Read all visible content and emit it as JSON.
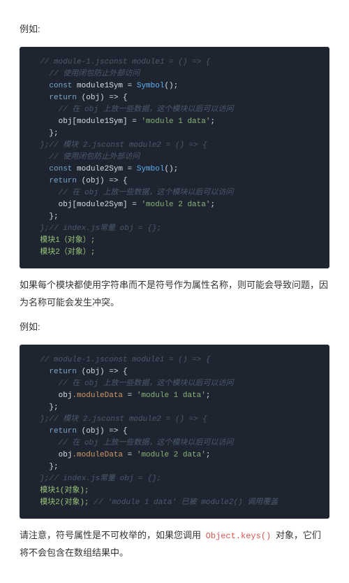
{
  "intro_label": "例如:",
  "code1": {
    "c1": "  // module-1.jsconst module1 = () => {",
    "c2": "    // 使用闭包防止外部访问",
    "l3_kw": "    const ",
    "l3_id": "module1Sym = ",
    "l3_fn": "Symbol",
    "l3_rest": "();",
    "l4_kw": "    return ",
    "l4_rest": "(obj) => {",
    "c5": "      // 在 obj 上放一些数据，这个模块以后可以访问",
    "l6_a": "      obj[module1Sym] = ",
    "l6_str": "'module 1 data'",
    "l6_b": ";",
    "l7": "    };",
    "c8": "  };// 模块 2.jsconst module2 = () => {",
    "c9": "    // 使用闭包防止外部访问",
    "l10_kw": "    const ",
    "l10_id": "module2Sym = ",
    "l10_fn": "Symbol",
    "l10_rest": "();",
    "l11_kw": "    return ",
    "l11_rest": "(obj) => {",
    "c12": "      // 在 obj 上放一些数据，这个模块以后可以访问",
    "l13_a": "      obj[module2Sym] = ",
    "l13_str": "'module 2 data'",
    "l13_b": ";",
    "l14": "    };",
    "c15": "  };// index.js常量 obj = {};",
    "l16": "  模块1（对象）;",
    "l17": "  模块2（对象）;"
  },
  "mid_para": "如果每个模块都使用字符串而不是符号作为属性名称，则可能会导致问题，因为名称可能会发生冲突。",
  "mid_label": "例如:",
  "code2": {
    "c1": "  // module-1.jsconst module1 = () => {",
    "l2_kw": "    return ",
    "l2_rest": "(obj) => {",
    "c3": "      // 在 obj 上放一些数据，这个模块以后可以访问",
    "l4_a": "      obj",
    "l4_m": ".moduleData",
    "l4_b": " = ",
    "l4_str": "'module 1 data'",
    "l4_c": ";",
    "l5": "    };",
    "c6": "  };// 模块 2.jsconst module2 = () => {",
    "l7_kw": "    return ",
    "l7_rest": "(obj) => {",
    "c8": "      // 在 obj 上放一些数据，这个模块以后可以访问",
    "l9_a": "      obj",
    "l9_m": ".moduleData",
    "l9_b": " = ",
    "l9_str": "'module 2 data'",
    "l9_c": ";",
    "l10": "    };",
    "c11": "  };// index.js常量 obj = {};",
    "l12": "  模块1(对象);",
    "l13a": "  模块2(对象); ",
    "c13b": "// 'module 1 data' 已被 module2() 调用覆盖"
  },
  "end": {
    "t1": "请注意，符号属性是不可枚举的，如果您调用 ",
    "code": "Object.keys()",
    "t2": " 对象，它们将不会包含在数组结果中。"
  }
}
